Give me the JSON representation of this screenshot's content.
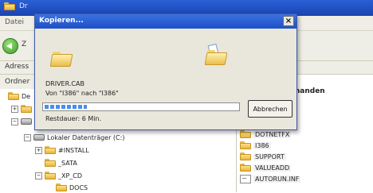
{
  "explorer": {
    "window_title": "Dr",
    "menu": [
      "Datei"
    ],
    "back_label": "Z",
    "address_label": "Adress",
    "folders_label": "Ordner",
    "right_header": "f der CD vorhanden",
    "tree": [
      {
        "label": "De",
        "kind": "desktop",
        "expander": ""
      },
      {
        "label": "",
        "kind": "folder",
        "expander": "+"
      },
      {
        "label": "",
        "kind": "computer",
        "expander": "−"
      },
      {
        "label": "Lokaler Datenträger (C:)",
        "kind": "drive",
        "expander": "−"
      },
      {
        "label": "#INSTALL",
        "kind": "folder",
        "expander": "+"
      },
      {
        "label": "_SATA",
        "kind": "folder",
        "expander": ""
      },
      {
        "label": "_XP_CD",
        "kind": "folder",
        "expander": "−"
      },
      {
        "label": "DOCS",
        "kind": "folder",
        "expander": ""
      }
    ],
    "files": [
      {
        "name": "DOTNETFX",
        "kind": "folder"
      },
      {
        "name": "I386",
        "kind": "folder"
      },
      {
        "name": "SUPPORT",
        "kind": "folder"
      },
      {
        "name": "VALUEADD",
        "kind": "folder"
      },
      {
        "name": "AUTORUN.INF",
        "kind": "textfile"
      }
    ]
  },
  "dialog": {
    "title": "Kopieren...",
    "close_glyph": "×",
    "filename": "DRIVER.CAB",
    "from_to": "Von \"I386\" nach \"I386\"",
    "progress_percent": 22,
    "remaining": "Restdauer: 6 Min.",
    "cancel_label": "Abbrechen"
  },
  "colors": {
    "titlebar": "#1e50c8",
    "dialog_face": "#e9e6dc",
    "progress": "#4a8ee8",
    "folder": "#e9be48"
  },
  "icons": {
    "close": "close-icon",
    "folder": "folder-icon",
    "back": "back-arrow-icon",
    "drive": "drive-icon"
  }
}
